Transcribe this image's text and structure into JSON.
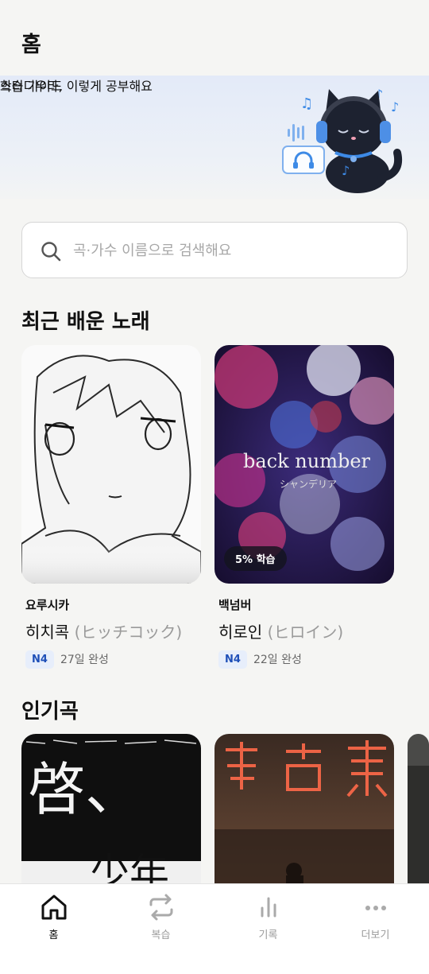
{
  "header": {
    "title": "홈"
  },
  "banner": {
    "eyebrow": "학습 가이드",
    "headline": "스터디우타, 이렇게 공부해요"
  },
  "search": {
    "placeholder": "곡·가수 이름으로 검색해요"
  },
  "recent": {
    "title": "최근 배운 노래",
    "songs": [
      {
        "artist": "요루시카",
        "title": "히치콕",
        "title_sub": "(ヒッチコック)",
        "level": "N4",
        "status": "27일 완성"
      },
      {
        "artist": "백넘버",
        "title": "히로인",
        "title_sub": "(ヒロイン)",
        "level": "N4",
        "status": "22일 완성",
        "progress_badge": "5% 학습",
        "cover_text": "back number",
        "cover_subtext": "シャンデリア"
      }
    ]
  },
  "popular": {
    "title": "인기곡",
    "covers": [
      {
        "cover_text": "啓、",
        "cover_subtext": "少年"
      }
    ]
  },
  "tabbar": {
    "items": [
      {
        "label": "홈",
        "icon": "home-icon"
      },
      {
        "label": "복습",
        "icon": "repeat-icon"
      },
      {
        "label": "기록",
        "icon": "chart-icon"
      },
      {
        "label": "더보기",
        "icon": "more-icon"
      }
    ],
    "active": "홈"
  },
  "colors": {
    "accent": "#1e4fb8",
    "badge_bg": "#e7eefb"
  }
}
